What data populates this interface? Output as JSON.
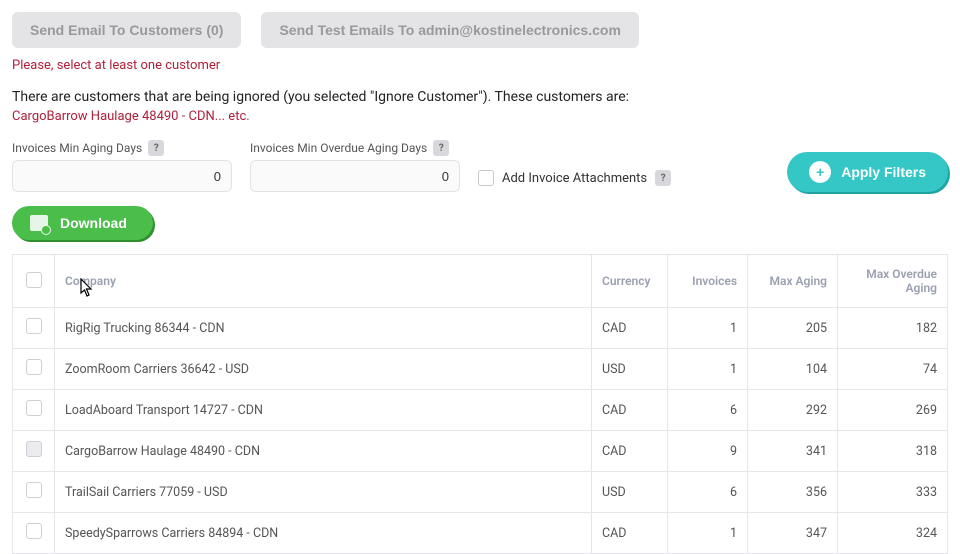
{
  "buttons": {
    "send_email": "Send Email To Customers (0)",
    "send_test": "Send Test Emails To admin@kostinelectronics.com",
    "apply": "Apply Filters",
    "download": "Download"
  },
  "warnings": {
    "select_one": "Please, select at least one customer",
    "ignored_line": "There are customers that are being ignored (you selected \"Ignore Customer\"). These customers are:",
    "ignored_detail": "CargoBarrow Haulage 48490 - CDN... etc."
  },
  "filters": {
    "min_aging_label": "Invoices Min Aging Days",
    "min_aging_value": "0",
    "min_overdue_label": "Invoices Min Overdue Aging Days",
    "min_overdue_value": "0",
    "attach_label": "Add Invoice Attachments"
  },
  "table": {
    "headers": {
      "company": "Company",
      "currency": "Currency",
      "invoices": "Invoices",
      "max_aging": "Max Aging",
      "max_overdue": "Max Overdue Aging"
    },
    "rows": [
      {
        "company": "RigRig Trucking 86344 - CDN",
        "currency": "CAD",
        "invoices": "1",
        "max_aging": "205",
        "max_overdue": "182",
        "dim": false
      },
      {
        "company": "ZoomRoom Carriers 36642 - USD",
        "currency": "USD",
        "invoices": "1",
        "max_aging": "104",
        "max_overdue": "74",
        "dim": false
      },
      {
        "company": "LoadAboard Transport 14727 - CDN",
        "currency": "CAD",
        "invoices": "6",
        "max_aging": "292",
        "max_overdue": "269",
        "dim": false
      },
      {
        "company": "CargoBarrow Haulage 48490 - CDN",
        "currency": "CAD",
        "invoices": "9",
        "max_aging": "341",
        "max_overdue": "318",
        "dim": true
      },
      {
        "company": "TrailSail Carriers 77059 - USD",
        "currency": "USD",
        "invoices": "6",
        "max_aging": "356",
        "max_overdue": "333",
        "dim": false
      },
      {
        "company": "SpeedySparrows Carriers 84894 - CDN",
        "currency": "CAD",
        "invoices": "1",
        "max_aging": "347",
        "max_overdue": "324",
        "dim": false
      }
    ]
  }
}
